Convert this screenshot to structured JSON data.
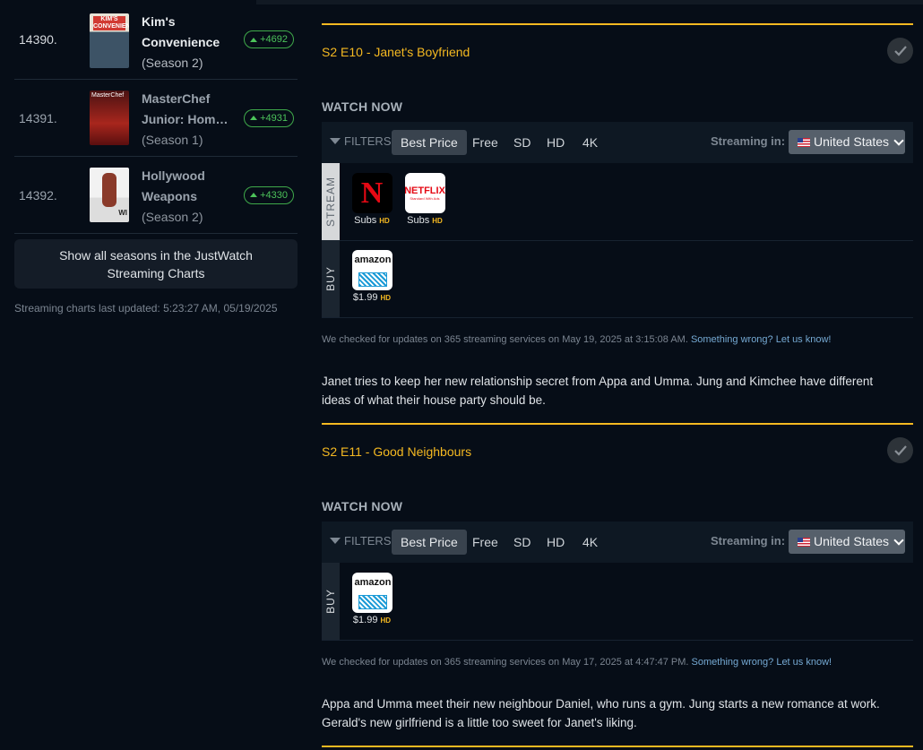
{
  "sidebar": {
    "rows": [
      {
        "rank": "14390.",
        "title": "Kim's Convenience",
        "title_line1": "Kim's",
        "title_line2": "Convenience",
        "season": "(Season 2)",
        "badge": "+4692"
      },
      {
        "rank": "14391.",
        "title": "MasterChef Junior: Hom…",
        "title_line1": "MasterChef",
        "title_line2": "Junior: Hom…",
        "season": "(Season 1)",
        "badge": "+4931"
      },
      {
        "rank": "14392.",
        "title": "Hollywood Weapons",
        "title_line1": "Hollywood",
        "title_line2": "Weapons",
        "season": "(Season 2)",
        "badge": "+4330"
      }
    ],
    "poster_texts": [
      "KIM'S CONVENIENCE",
      "MasterChef",
      "WI"
    ],
    "show_all_label": "Show all seasons in the JustWatch Streaming Charts",
    "updated": "Streaming charts last updated: 5:23:27 AM, 05/19/2025"
  },
  "filters": {
    "label": "FILTERS",
    "options": [
      "Best Price",
      "Free",
      "SD",
      "HD",
      "4K"
    ],
    "active": "Best Price",
    "streaming_in_label": "Streaming in:",
    "country": "United States"
  },
  "episodes": [
    {
      "title": "S2 E10 - Janet's Boyfriend",
      "watch_now": "WATCH NOW",
      "stream_label": "STREAM",
      "buy_label": "BUY",
      "stream": [
        {
          "logo": "netflix-n",
          "logo_text": "N",
          "price": "Subs",
          "quality": "HD"
        },
        {
          "logo": "netflix-ads",
          "logo_text": "NETFLIX",
          "logo_subtext": "Standard With Ads",
          "price": "Subs",
          "quality": "HD"
        }
      ],
      "buy": [
        {
          "logo": "amazon",
          "logo_text": "amazon",
          "price": "$1.99",
          "quality": "HD"
        }
      ],
      "checked": "We checked for updates on 365 streaming services on May 19, 2025 at 3:15:08 AM.",
      "report_link": "Something wrong? Let us know!",
      "synopsis": "Janet tries to keep her new relationship secret from Appa and Umma. Jung and Kimchee have different ideas of what their house party should be."
    },
    {
      "title": "S2 E11 - Good Neighbours",
      "watch_now": "WATCH NOW",
      "buy_label": "BUY",
      "buy": [
        {
          "logo": "amazon",
          "logo_text": "amazon",
          "price": "$1.99",
          "quality": "HD"
        }
      ],
      "checked": "We checked for updates on 365 streaming services on May 17, 2025 at 4:47:47 PM.",
      "report_link": "Something wrong? Let us know!",
      "synopsis": "Appa and Umma meet their new neighbour Daniel, who runs a gym. Jung starts a new romance at work. Gerald's new girlfriend is a little too sweet for Janet's liking."
    }
  ],
  "colors": {
    "accent_gold": "#f5b921",
    "badge_green": "#4cc35a",
    "background": "#060d17",
    "link_blue": "#75a9d3"
  }
}
